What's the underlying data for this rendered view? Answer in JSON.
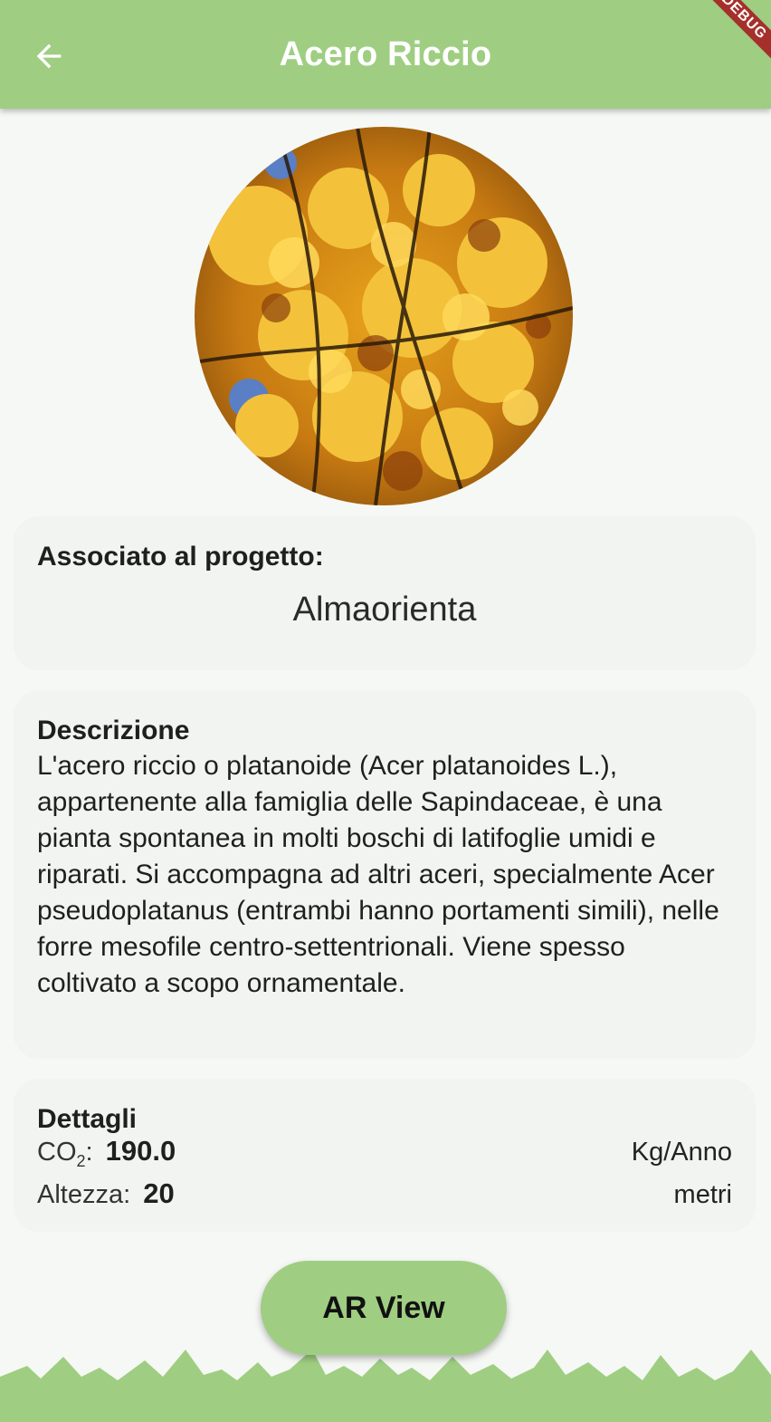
{
  "appbar": {
    "title": "Acero Riccio",
    "debug_label": "DEBUG"
  },
  "project": {
    "label": "Associato al progetto:",
    "name": "Almaorienta"
  },
  "description": {
    "label": "Descrizione",
    "text": "L'acero riccio o platanoide (Acer platanoides L.), appartenente alla famiglia delle Sapindaceae, è una pianta spontanea in molti boschi di latifoglie umidi e riparati. Si accompagna ad altri aceri, specialmente Acer pseudoplatanus (entrambi hanno portamenti simili), nelle forre mesofile centro-settentrionali. Viene spesso coltivato a scopo ornamentale."
  },
  "details": {
    "label": "Dettagli",
    "co2_label": "CO",
    "co2_sub": "2",
    "co2_colon": ":",
    "co2_value": "190.0",
    "co2_unit": "Kg/Anno",
    "height_label": "Altezza:",
    "height_value": "20",
    "height_unit": "metri"
  },
  "ar_button": {
    "label": "AR View"
  },
  "colors": {
    "accent": "#9fce82",
    "card": "#f2f4f1",
    "background": "#f6f8f5",
    "debug": "#a5302b"
  },
  "icons": {
    "back": "arrow-left-icon"
  }
}
